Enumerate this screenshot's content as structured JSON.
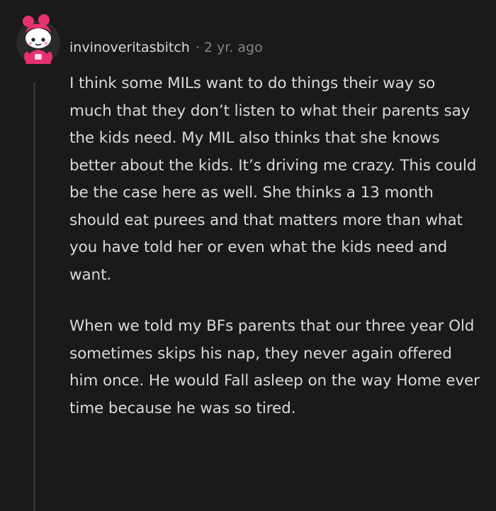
{
  "comment": {
    "username": "invinoveritasbitch",
    "separator": "·",
    "timestamp": "2 yr. ago",
    "avatar_icon": "snoo-avatar-icon",
    "paragraphs": [
      "I think some MILs want to do things their way so much that they don’t listen to what their parents say the kids need. My MIL also thinks that she knows better about the kids. It’s driving me crazy. This could be the case here as well. She thinks a 13 month should eat purees and that matters more than what you have told her or even what the kids need and want.",
      "When we told my BFs parents that our three year Old sometimes skips his nap, they never again offered him once. He would Fall asleep on the way Home ever time because he was so tired."
    ]
  },
  "colors": {
    "background": "#1a1a1b",
    "text": "#d7dadc",
    "meta": "#818384",
    "thread_line": "#343536",
    "avatar_pink": "#e8306f"
  }
}
